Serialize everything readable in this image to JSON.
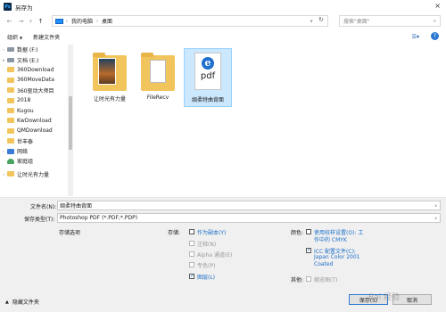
{
  "window": {
    "title": "另存为",
    "app_icon": "Ps",
    "close_glyph": "×"
  },
  "nav": {
    "back": "←",
    "forward": "→",
    "recent": "∨",
    "up": "↑",
    "breadcrumbs": [
      "我的电脑",
      "桌面"
    ],
    "separator": "›",
    "search_placeholder": "搜索\"桌面\"",
    "search_icon": "search-icon",
    "refresh": "↻"
  },
  "toolbar": {
    "organize": "组织",
    "new_folder": "新建文件夹",
    "view": "☰▾",
    "help": "?"
  },
  "sidebar": {
    "items": [
      {
        "label": "数据 (F:)",
        "icon": "drive-icon"
      },
      {
        "label": "文档 (E:)",
        "icon": "drive-icon"
      },
      {
        "label": "360Download",
        "icon": "folder-icon"
      },
      {
        "label": "360MoveData",
        "icon": "folder-icon"
      },
      {
        "label": "360驱动大师目",
        "icon": "folder-icon"
      },
      {
        "label": "2018",
        "icon": "folder-icon"
      },
      {
        "label": "Kugou",
        "icon": "folder-icon"
      },
      {
        "label": "KwDownload",
        "icon": "folder-icon"
      },
      {
        "label": "QMDownload",
        "icon": "folder-icon"
      },
      {
        "label": "世丰泰",
        "icon": "folder-icon"
      },
      {
        "label": "网络",
        "icon": "network-icon"
      },
      {
        "label": "家庭组",
        "icon": "homegroup-icon"
      },
      {
        "label": "让时光有力量",
        "icon": "folder-icon"
      }
    ]
  },
  "files": [
    {
      "label": "让时光有力量",
      "type": "folder"
    },
    {
      "label": "FileRecv",
      "type": "folder"
    },
    {
      "label": "绸柔特曲背面",
      "type": "pdf",
      "badge": "e",
      "thumb_text": "pdf"
    }
  ],
  "form": {
    "filename_label": "文件名(N):",
    "filename_value": "绸柔特曲背面",
    "filetype_label": "保存类型(T):",
    "filetype_value": "Photoshop PDF (*.PDF;*.PDP)",
    "save_options_label": "存储选项",
    "storage_label": "存储:",
    "storage_options": [
      {
        "label": "作为副本(Y)",
        "checked": false,
        "enabled": true
      },
      {
        "label": "注释(N)",
        "checked": false,
        "enabled": false
      },
      {
        "label": "Alpha 通道(E)",
        "checked": false,
        "enabled": false
      },
      {
        "label": "专色(P)",
        "checked": false,
        "enabled": false
      },
      {
        "label": "图层(L)",
        "checked": true,
        "enabled": true
      }
    ],
    "color_label": "颜色:",
    "color_option_1": "使用校样设置(O): 工",
    "color_option_1_line2": "作中的 CMYK",
    "color_option_2": "ICC 配置文件(C):",
    "color_option_2_line2": "Japan Color 2001",
    "color_option_2_line3": "Coated",
    "other_label": "其他:",
    "thumbnail_label": "缩览图(T)",
    "save_button": "保存(S)",
    "cancel_button": "取消",
    "hide_folders": "隐藏文件夹"
  },
  "watermark": "Bai 经验"
}
